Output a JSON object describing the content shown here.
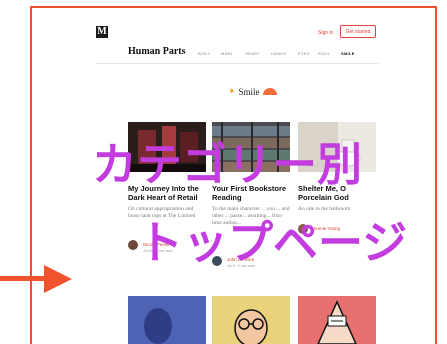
{
  "header": {
    "logo_letter": "M",
    "signin_label": "Sign in",
    "get_started_label": "Get started"
  },
  "publication": {
    "title": "Human Parts",
    "nav": [
      "BODY",
      "MIND",
      "HEART",
      "HANDS",
      "EYES",
      "SOUL",
      "SMILE"
    ],
    "active_nav": "SMILE"
  },
  "section": {
    "title": "Smile"
  },
  "cards": [
    {
      "title": "My Journey Into the Dark Heart of Retail",
      "desc": "On cultural appropriation and lousy tank tops at The Limited",
      "author": "Nicole Peeler",
      "meta": "Jul 11 · 8 min read"
    },
    {
      "title": "Your First Bookstore Reading",
      "desc": "To the main character ... you ... and other ... passe... awaiting... first-time author...",
      "author": "John DiFelice",
      "meta": "Jul 9 · 4 min read"
    },
    {
      "title": "Shelter Me, O Porcelain God",
      "desc": "An ode to the bathroom",
      "author": "Jennie Young",
      "meta": ""
    }
  ],
  "overlay": {
    "line1": "カテゴリー別",
    "line2": "トップページ"
  },
  "colors": {
    "accent": "#f0522b",
    "overlay_text": "#c23ce0",
    "brand_red": "#e0433b"
  }
}
